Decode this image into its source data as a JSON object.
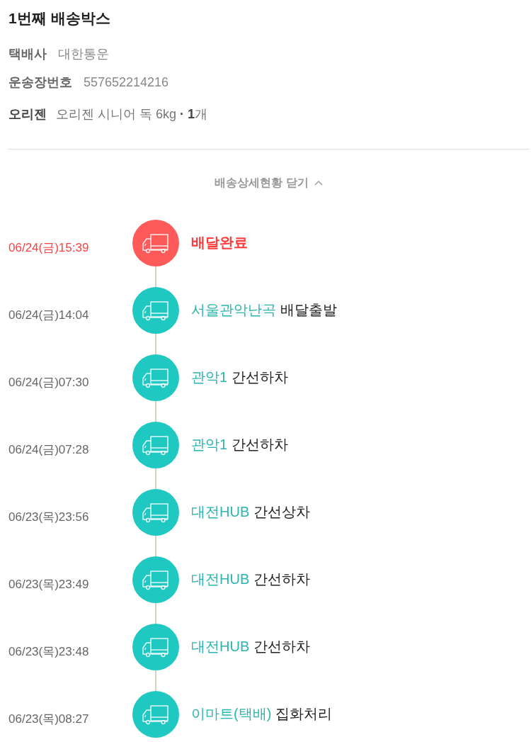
{
  "box": {
    "title": "1번째 배송박스",
    "fields": [
      {
        "label": "택배사",
        "value": "대한통운"
      },
      {
        "label": "운송장번호",
        "value": "557652214216"
      }
    ],
    "product": {
      "brand": "오리젠",
      "name": "오리젠 시니어 독 6kg **·** **1**개"
    }
  },
  "toggle": {
    "label": "배송상세현황 닫기",
    "expanded": true
  },
  "events": [
    {
      "kind": "delivered",
      "time": "06/24(금)15:39",
      "status": "배달완료"
    },
    {
      "kind": "transit",
      "time": "06/24(금)14:04",
      "location": "서울관악난곡",
      "status": "배달출발"
    },
    {
      "kind": "transit",
      "time": "06/24(금)07:30",
      "location": "관악1",
      "status": "간선하차"
    },
    {
      "kind": "transit",
      "time": "06/24(금)07:28",
      "location": "관악1",
      "status": "간선하차"
    },
    {
      "kind": "transit",
      "time": "06/23(목)23:56",
      "location": "대전HUB",
      "status": "간선상차"
    },
    {
      "kind": "transit",
      "time": "06/23(목)23:49",
      "location": "대전HUB",
      "status": "간선하차"
    },
    {
      "kind": "transit",
      "time": "06/23(목)23:48",
      "location": "대전HUB",
      "status": "간선하차"
    },
    {
      "kind": "transit",
      "time": "06/23(목)08:27",
      "location": "이마트(택배)",
      "status": "집화처리"
    }
  ]
}
